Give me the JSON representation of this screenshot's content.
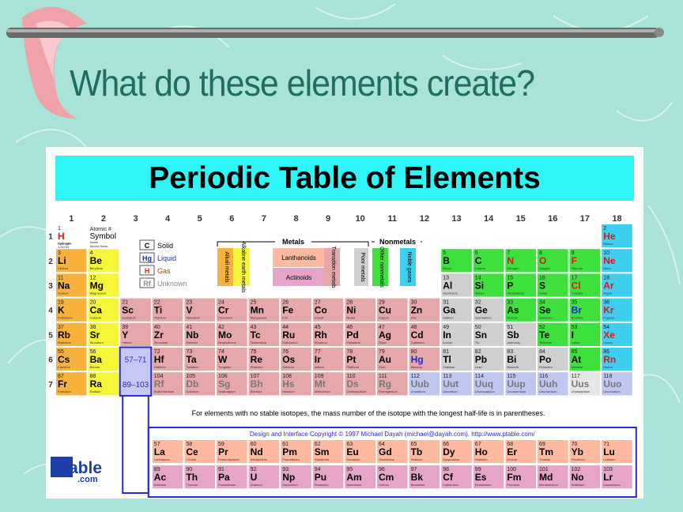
{
  "slide": {
    "title": "What do these elements create?"
  },
  "table": {
    "header": "Periodic Table of Elements",
    "groups": [
      "1",
      "2",
      "3",
      "4",
      "5",
      "6",
      "7",
      "8",
      "9",
      "10",
      "11",
      "12",
      "13",
      "14",
      "15",
      "16",
      "17",
      "18"
    ],
    "periods": [
      "1",
      "2",
      "3",
      "4",
      "5",
      "6",
      "7"
    ],
    "key": {
      "atomic_label": "Atomic #",
      "symbol_label": "Symbol",
      "name_label": "Name",
      "mass_label": "Atomic Mass",
      "sample_number": "1",
      "sample_symbol": "H",
      "sample_name": "Hydrogen",
      "sample_mass": "1.00794"
    },
    "legend_states": [
      {
        "sym": "C",
        "label": "Solid",
        "color": "#000000"
      },
      {
        "sym": "Hg",
        "label": "Liquid",
        "color": "#1a2bd1"
      },
      {
        "sym": "H",
        "label": "Gas",
        "color": "#d12b1a"
      },
      {
        "sym": "Rf",
        "label": "Unknown",
        "color": "#8a8a8a"
      }
    ],
    "metals_label": "Metals",
    "nonmetals_label": "Nonmetals",
    "categories": {
      "alkali": "Alkali metals",
      "alkaline": "Alkaline earth metals",
      "lanthanoids": "Lanthanoids",
      "actinoids": "Actinoids",
      "transition": "Transition metals",
      "poor": "Poor metals",
      "othernon": "Other nonmetals",
      "noble": "Noble gases"
    },
    "range_6": "57–71",
    "range_7": "89–103",
    "note": "For elements with no stable isotopes, the mass number of the isotope with the longest half-life is in parentheses.",
    "copyright": "Design and Interface Copyright © 1997 Michael Dayah (michael@dayah.com). http://www.ptable.com/",
    "logo_top": "Ptable",
    "logo_bottom": ".com",
    "colors": {
      "alkali": "#f7b23e",
      "alkaline": "#f5f53a",
      "transition": "#e5a7a7",
      "poor": "#cfcfcf",
      "othernon": "#3ee03e",
      "halogen": "#f0f04a",
      "noble": "#3ecff0",
      "lanthanoid": "#ffb9a1",
      "actinoid": "#e6a4c8",
      "unknown": "#e6e6e6",
      "post": "#bfc7f0"
    },
    "main_elements": [
      {
        "n": "1",
        "s": "H",
        "name": "Hydrogen",
        "c": "hydrogen",
        "g": 1,
        "p": 1
      },
      {
        "n": "2",
        "s": "He",
        "name": "Helium",
        "c": "noble",
        "g": 18,
        "p": 1
      },
      {
        "n": "3",
        "s": "Li",
        "name": "Lithium",
        "c": "alkali",
        "g": 1,
        "p": 2
      },
      {
        "n": "4",
        "s": "Be",
        "name": "Beryllium",
        "c": "alkaline",
        "g": 2,
        "p": 2
      },
      {
        "n": "5",
        "s": "B",
        "name": "Boron",
        "c": "othernon",
        "g": 13,
        "p": 2
      },
      {
        "n": "6",
        "s": "C",
        "name": "Carbon",
        "c": "othernon",
        "g": 14,
        "p": 2
      },
      {
        "n": "7",
        "s": "N",
        "name": "Nitrogen",
        "c": "othernon",
        "g": 15,
        "p": 2
      },
      {
        "n": "8",
        "s": "O",
        "name": "Oxygen",
        "c": "othernon",
        "g": 16,
        "p": 2
      },
      {
        "n": "9",
        "s": "F",
        "name": "Fluorine",
        "c": "othernon",
        "g": 17,
        "p": 2
      },
      {
        "n": "10",
        "s": "Ne",
        "name": "Neon",
        "c": "noble",
        "g": 18,
        "p": 2
      },
      {
        "n": "11",
        "s": "Na",
        "name": "Sodium",
        "c": "alkali",
        "g": 1,
        "p": 3
      },
      {
        "n": "12",
        "s": "Mg",
        "name": "Magnesium",
        "c": "alkaline",
        "g": 2,
        "p": 3
      },
      {
        "n": "13",
        "s": "Al",
        "name": "Aluminium",
        "c": "poor",
        "g": 13,
        "p": 3
      },
      {
        "n": "14",
        "s": "Si",
        "name": "Silicon",
        "c": "othernon",
        "g": 14,
        "p": 3
      },
      {
        "n": "15",
        "s": "P",
        "name": "Phosphorus",
        "c": "othernon",
        "g": 15,
        "p": 3
      },
      {
        "n": "16",
        "s": "S",
        "name": "Sulfur",
        "c": "othernon",
        "g": 16,
        "p": 3
      },
      {
        "n": "17",
        "s": "Cl",
        "name": "Chlorine",
        "c": "othernon",
        "g": 17,
        "p": 3
      },
      {
        "n": "18",
        "s": "Ar",
        "name": "Argon",
        "c": "noble",
        "g": 18,
        "p": 3
      },
      {
        "n": "19",
        "s": "K",
        "name": "Potassium",
        "c": "alkali",
        "g": 1,
        "p": 4
      },
      {
        "n": "20",
        "s": "Ca",
        "name": "Calcium",
        "c": "alkaline",
        "g": 2,
        "p": 4
      },
      {
        "n": "21",
        "s": "Sc",
        "name": "Scandium",
        "c": "transition",
        "g": 3,
        "p": 4
      },
      {
        "n": "22",
        "s": "Ti",
        "name": "Titanium",
        "c": "transition",
        "g": 4,
        "p": 4
      },
      {
        "n": "23",
        "s": "V",
        "name": "Vanadium",
        "c": "transition",
        "g": 5,
        "p": 4
      },
      {
        "n": "24",
        "s": "Cr",
        "name": "Chromium",
        "c": "transition",
        "g": 6,
        "p": 4
      },
      {
        "n": "25",
        "s": "Mn",
        "name": "Manganese",
        "c": "transition",
        "g": 7,
        "p": 4
      },
      {
        "n": "26",
        "s": "Fe",
        "name": "Iron",
        "c": "transition",
        "g": 8,
        "p": 4
      },
      {
        "n": "27",
        "s": "Co",
        "name": "Cobalt",
        "c": "transition",
        "g": 9,
        "p": 4
      },
      {
        "n": "28",
        "s": "Ni",
        "name": "Nickel",
        "c": "transition",
        "g": 10,
        "p": 4
      },
      {
        "n": "29",
        "s": "Cu",
        "name": "Copper",
        "c": "transition",
        "g": 11,
        "p": 4
      },
      {
        "n": "30",
        "s": "Zn",
        "name": "Zinc",
        "c": "transition",
        "g": 12,
        "p": 4
      },
      {
        "n": "31",
        "s": "Ga",
        "name": "Gallium",
        "c": "poor",
        "g": 13,
        "p": 4
      },
      {
        "n": "32",
        "s": "Ge",
        "name": "Germanium",
        "c": "poor",
        "g": 14,
        "p": 4
      },
      {
        "n": "33",
        "s": "As",
        "name": "Arsenic",
        "c": "othernon",
        "g": 15,
        "p": 4
      },
      {
        "n": "34",
        "s": "Se",
        "name": "Selenium",
        "c": "othernon",
        "g": 16,
        "p": 4
      },
      {
        "n": "35",
        "s": "Br",
        "name": "Bromine",
        "c": "othernon",
        "g": 17,
        "p": 4
      },
      {
        "n": "36",
        "s": "Kr",
        "name": "Krypton",
        "c": "noble",
        "g": 18,
        "p": 4
      },
      {
        "n": "37",
        "s": "Rb",
        "name": "Rubidium",
        "c": "alkali",
        "g": 1,
        "p": 5
      },
      {
        "n": "38",
        "s": "Sr",
        "name": "Strontium",
        "c": "alkaline",
        "g": 2,
        "p": 5
      },
      {
        "n": "39",
        "s": "Y",
        "name": "Yttrium",
        "c": "transition",
        "g": 3,
        "p": 5
      },
      {
        "n": "40",
        "s": "Zr",
        "name": "Zirconium",
        "c": "transition",
        "g": 4,
        "p": 5
      },
      {
        "n": "41",
        "s": "Nb",
        "name": "Niobium",
        "c": "transition",
        "g": 5,
        "p": 5
      },
      {
        "n": "42",
        "s": "Mo",
        "name": "Molybdenum",
        "c": "transition",
        "g": 6,
        "p": 5
      },
      {
        "n": "43",
        "s": "Tc",
        "name": "Technetium",
        "c": "transition",
        "g": 7,
        "p": 5
      },
      {
        "n": "44",
        "s": "Ru",
        "name": "Ruthenium",
        "c": "transition",
        "g": 8,
        "p": 5
      },
      {
        "n": "45",
        "s": "Rh",
        "name": "Rhodium",
        "c": "transition",
        "g": 9,
        "p": 5
      },
      {
        "n": "46",
        "s": "Pd",
        "name": "Palladium",
        "c": "transition",
        "g": 10,
        "p": 5
      },
      {
        "n": "47",
        "s": "Ag",
        "name": "Silver",
        "c": "transition",
        "g": 11,
        "p": 5
      },
      {
        "n": "48",
        "s": "Cd",
        "name": "Cadmium",
        "c": "transition",
        "g": 12,
        "p": 5
      },
      {
        "n": "49",
        "s": "In",
        "name": "Indium",
        "c": "poor",
        "g": 13,
        "p": 5
      },
      {
        "n": "50",
        "s": "Sn",
        "name": "Tin",
        "c": "poor",
        "g": 14,
        "p": 5
      },
      {
        "n": "51",
        "s": "Sb",
        "name": "Antimony",
        "c": "poor",
        "g": 15,
        "p": 5
      },
      {
        "n": "52",
        "s": "Te",
        "name": "Tellurium",
        "c": "othernon",
        "g": 16,
        "p": 5
      },
      {
        "n": "53",
        "s": "I",
        "name": "Iodine",
        "c": "othernon",
        "g": 17,
        "p": 5
      },
      {
        "n": "54",
        "s": "Xe",
        "name": "Xenon",
        "c": "noble",
        "g": 18,
        "p": 5
      },
      {
        "n": "55",
        "s": "Cs",
        "name": "Caesium",
        "c": "alkali",
        "g": 1,
        "p": 6
      },
      {
        "n": "56",
        "s": "Ba",
        "name": "Barium",
        "c": "alkaline",
        "g": 2,
        "p": 6
      },
      {
        "n": "72",
        "s": "Hf",
        "name": "Hafnium",
        "c": "transition",
        "g": 4,
        "p": 6
      },
      {
        "n": "73",
        "s": "Ta",
        "name": "Tantalum",
        "c": "transition",
        "g": 5,
        "p": 6
      },
      {
        "n": "74",
        "s": "W",
        "name": "Tungsten",
        "c": "transition",
        "g": 6,
        "p": 6
      },
      {
        "n": "75",
        "s": "Re",
        "name": "Rhenium",
        "c": "transition",
        "g": 7,
        "p": 6
      },
      {
        "n": "76",
        "s": "Os",
        "name": "Osmium",
        "c": "transition",
        "g": 8,
        "p": 6
      },
      {
        "n": "77",
        "s": "Ir",
        "name": "Iridium",
        "c": "transition",
        "g": 9,
        "p": 6
      },
      {
        "n": "78",
        "s": "Pt",
        "name": "Platinum",
        "c": "transition",
        "g": 10,
        "p": 6
      },
      {
        "n": "79",
        "s": "Au",
        "name": "Gold",
        "c": "transition",
        "g": 11,
        "p": 6
      },
      {
        "n": "80",
        "s": "Hg",
        "name": "Mercury",
        "c": "transition",
        "g": 12,
        "p": 6
      },
      {
        "n": "81",
        "s": "Tl",
        "name": "Thallium",
        "c": "poor",
        "g": 13,
        "p": 6
      },
      {
        "n": "82",
        "s": "Pb",
        "name": "Lead",
        "c": "poor",
        "g": 14,
        "p": 6
      },
      {
        "n": "83",
        "s": "Bi",
        "name": "Bismuth",
        "c": "poor",
        "g": 15,
        "p": 6
      },
      {
        "n": "84",
        "s": "Po",
        "name": "Polonium",
        "c": "poor",
        "g": 16,
        "p": 6
      },
      {
        "n": "85",
        "s": "At",
        "name": "Astatine",
        "c": "othernon",
        "g": 17,
        "p": 6
      },
      {
        "n": "86",
        "s": "Rn",
        "name": "Radon",
        "c": "noble",
        "g": 18,
        "p": 6
      },
      {
        "n": "87",
        "s": "Fr",
        "name": "Francium",
        "c": "alkali",
        "g": 1,
        "p": 7
      },
      {
        "n": "88",
        "s": "Ra",
        "name": "Radium",
        "c": "alkaline",
        "g": 2,
        "p": 7
      },
      {
        "n": "104",
        "s": "Rf",
        "name": "Rutherfordium",
        "c": "transition",
        "g": 4,
        "p": 7
      },
      {
        "n": "105",
        "s": "Db",
        "name": "Dubnium",
        "c": "transition",
        "g": 5,
        "p": 7
      },
      {
        "n": "106",
        "s": "Sg",
        "name": "Seaborgium",
        "c": "transition",
        "g": 6,
        "p": 7
      },
      {
        "n": "107",
        "s": "Bh",
        "name": "Bohrium",
        "c": "transition",
        "g": 7,
        "p": 7
      },
      {
        "n": "108",
        "s": "Hs",
        "name": "Hassium",
        "c": "transition",
        "g": 8,
        "p": 7
      },
      {
        "n": "109",
        "s": "Mt",
        "name": "Meitnerium",
        "c": "transition",
        "g": 9,
        "p": 7
      },
      {
        "n": "110",
        "s": "Ds",
        "name": "Darmstadtium",
        "c": "transition",
        "g": 10,
        "p": 7
      },
      {
        "n": "111",
        "s": "Rg",
        "name": "Roentgenium",
        "c": "transition",
        "g": 11,
        "p": 7
      },
      {
        "n": "112",
        "s": "Uub",
        "name": "Ununbium",
        "c": "post",
        "g": 12,
        "p": 7
      },
      {
        "n": "113",
        "s": "Uut",
        "name": "Ununtrium",
        "c": "post",
        "g": 13,
        "p": 7
      },
      {
        "n": "114",
        "s": "Uuq",
        "name": "Ununquadium",
        "c": "post",
        "g": 14,
        "p": 7
      },
      {
        "n": "115",
        "s": "Uup",
        "name": "Ununpentium",
        "c": "post",
        "g": 15,
        "p": 7
      },
      {
        "n": "116",
        "s": "Uuh",
        "name": "Ununhexium",
        "c": "post",
        "g": 16,
        "p": 7
      },
      {
        "n": "117",
        "s": "Uus",
        "name": "Ununseptium",
        "c": "unknown",
        "g": 17,
        "p": 7
      },
      {
        "n": "118",
        "s": "Uuo",
        "name": "Ununoctium",
        "c": "post",
        "g": 18,
        "p": 7
      }
    ],
    "lanthanides": [
      {
        "n": "57",
        "s": "La",
        "name": "Lanthanum"
      },
      {
        "n": "58",
        "s": "Ce",
        "name": "Cerium"
      },
      {
        "n": "59",
        "s": "Pr",
        "name": "Praseodymium"
      },
      {
        "n": "60",
        "s": "Nd",
        "name": "Neodymium"
      },
      {
        "n": "61",
        "s": "Pm",
        "name": "Promethium"
      },
      {
        "n": "62",
        "s": "Sm",
        "name": "Samarium"
      },
      {
        "n": "63",
        "s": "Eu",
        "name": "Europium"
      },
      {
        "n": "64",
        "s": "Gd",
        "name": "Gadolinium"
      },
      {
        "n": "65",
        "s": "Tb",
        "name": "Terbium"
      },
      {
        "n": "66",
        "s": "Dy",
        "name": "Dysprosium"
      },
      {
        "n": "67",
        "s": "Ho",
        "name": "Holmium"
      },
      {
        "n": "68",
        "s": "Er",
        "name": "Erbium"
      },
      {
        "n": "69",
        "s": "Tm",
        "name": "Thulium"
      },
      {
        "n": "70",
        "s": "Yb",
        "name": "Ytterbium"
      },
      {
        "n": "71",
        "s": "Lu",
        "name": "Lutetium"
      }
    ],
    "actinides": [
      {
        "n": "89",
        "s": "Ac",
        "name": "Actinium"
      },
      {
        "n": "90",
        "s": "Th",
        "name": "Thorium"
      },
      {
        "n": "91",
        "s": "Pa",
        "name": "Protactinium"
      },
      {
        "n": "92",
        "s": "U",
        "name": "Uranium"
      },
      {
        "n": "93",
        "s": "Np",
        "name": "Neptunium"
      },
      {
        "n": "94",
        "s": "Pu",
        "name": "Plutonium"
      },
      {
        "n": "95",
        "s": "Am",
        "name": "Americium"
      },
      {
        "n": "96",
        "s": "Cm",
        "name": "Curium"
      },
      {
        "n": "97",
        "s": "Bk",
        "name": "Berkelium"
      },
      {
        "n": "98",
        "s": "Cf",
        "name": "Californium"
      },
      {
        "n": "99",
        "s": "Es",
        "name": "Einsteinium"
      },
      {
        "n": "100",
        "s": "Fm",
        "name": "Fermium"
      },
      {
        "n": "101",
        "s": "Md",
        "name": "Mendelevium"
      },
      {
        "n": "102",
        "s": "No",
        "name": "Nobelium"
      },
      {
        "n": "103",
        "s": "Lr",
        "name": "Lawrencium"
      }
    ]
  }
}
